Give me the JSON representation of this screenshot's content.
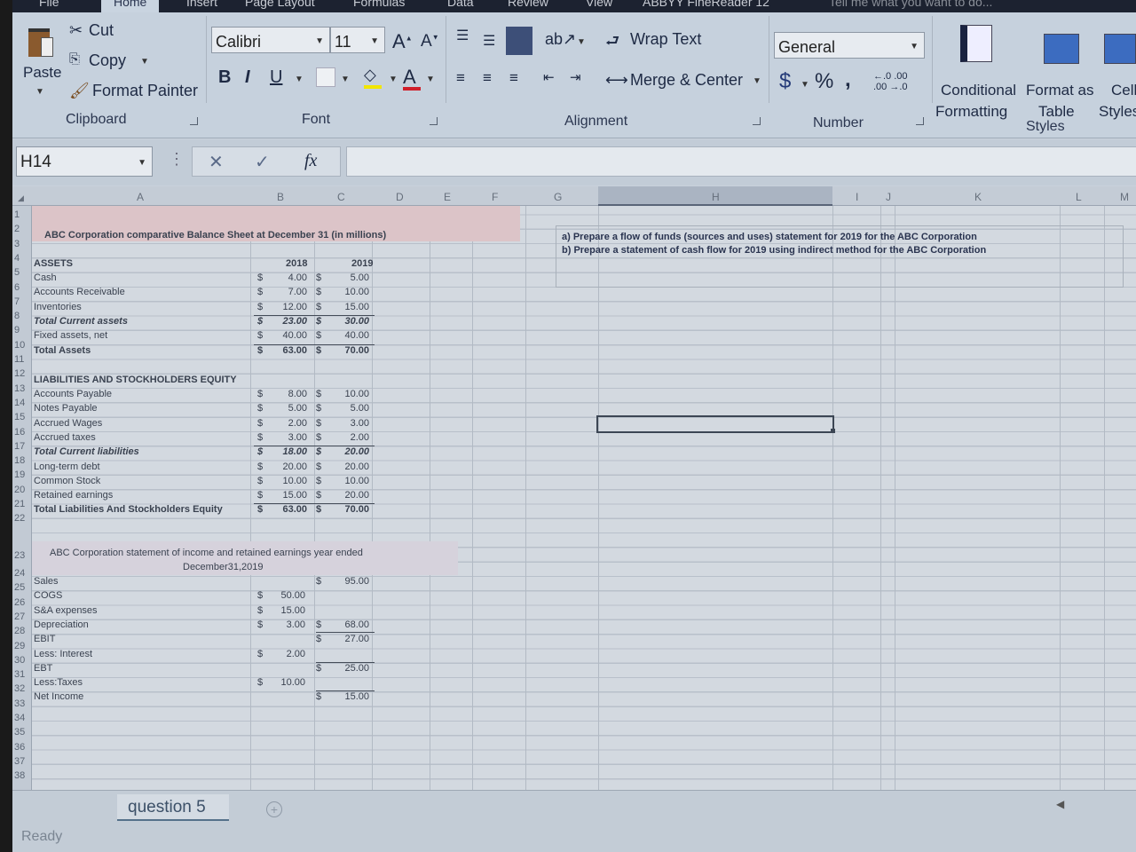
{
  "tabs": [
    "File",
    "Home",
    "Insert",
    "Page Layout",
    "Formulas",
    "Data",
    "Review",
    "View",
    "ABBYY FineReader 12"
  ],
  "tell_me": "Tell me what you want to do...",
  "ribbon": {
    "clipboard": {
      "paste": "Paste",
      "cut": "Cut",
      "copy": "Copy",
      "format_painter": "Format Painter",
      "label": "Clipboard"
    },
    "font": {
      "name": "Calibri",
      "size": "11",
      "bold": "B",
      "italic": "I",
      "underline": "U",
      "label": "Font",
      "fill_color": "#f2e600",
      "font_color": "#d01f2a"
    },
    "alignment": {
      "wrap_text": "Wrap Text",
      "merge_center": "Merge & Center",
      "label": "Alignment"
    },
    "number": {
      "format": "General",
      "currency": "$",
      "percent": "%",
      "comma": ",",
      "inc_decimal": "←.0 .00",
      "dec_decimal": ".00 →.0",
      "label": "Number"
    },
    "styles": {
      "conditional": "Conditional",
      "conditional2": "Formatting",
      "format_table": "Format as",
      "format_table2": "Table",
      "cell_styles": "Cell",
      "cell_styles2": "Styles",
      "label": "Styles"
    }
  },
  "formula_bar": {
    "name_box": "H14",
    "cancel": "✕",
    "enter": "✓",
    "fx": "fx",
    "content": ""
  },
  "columns": [
    "A",
    "B",
    "C",
    "D",
    "E",
    "F",
    "G",
    "H",
    "I",
    "J",
    "K",
    "L",
    "M"
  ],
  "rows": [
    "1",
    "2",
    "3",
    "4",
    "5",
    "6",
    "7",
    "8",
    "9",
    "10",
    "11",
    "12",
    "13",
    "14",
    "15",
    "16",
    "17",
    "18",
    "19",
    "20",
    "21",
    "22",
    "23",
    "24",
    "25",
    "26",
    "27",
    "28",
    "29",
    "30",
    "31",
    "32",
    "33",
    "34",
    "35",
    "36",
    "37",
    "38"
  ],
  "balance_sheet": {
    "title": "ABC Corporation comparative Balance Sheet at December 31   (in millions)",
    "assets_header": "ASSETS",
    "year1": "2018",
    "year2": "2019",
    "currency": "$",
    "asset_rows": [
      {
        "label": "Cash",
        "v2018": "4.00",
        "v2019": "5.00",
        "style": "normal"
      },
      {
        "label": "Accounts Receivable",
        "v2018": "7.00",
        "v2019": "10.00",
        "style": "normal"
      },
      {
        "label": "Inventories",
        "v2018": "12.00",
        "v2019": "15.00",
        "style": "normal"
      },
      {
        "label": "Total Current assets",
        "v2018": "23.00",
        "v2019": "30.00",
        "style": "bold-italic"
      },
      {
        "label": "Fixed assets, net",
        "v2018": "40.00",
        "v2019": "40.00",
        "style": "normal"
      },
      {
        "label": "Total Assets",
        "v2018": "63.00",
        "v2019": "70.00",
        "style": "bold"
      }
    ],
    "liab_header": "LIABILITIES AND STOCKHOLDERS EQUITY",
    "liab_rows": [
      {
        "label": "Accounts Payable",
        "v2018": "8.00",
        "v2019": "10.00",
        "style": "normal"
      },
      {
        "label": "Notes Payable",
        "v2018": "5.00",
        "v2019": "5.00",
        "style": "normal"
      },
      {
        "label": "Accrued Wages",
        "v2018": "2.00",
        "v2019": "3.00",
        "style": "normal"
      },
      {
        "label": "Accrued taxes",
        "v2018": "3.00",
        "v2019": "2.00",
        "style": "normal"
      },
      {
        "label": "Total Current liabilities",
        "v2018": "18.00",
        "v2019": "20.00",
        "style": "bold-italic"
      },
      {
        "label": "Long-term debt",
        "v2018": "20.00",
        "v2019": "20.00",
        "style": "normal"
      },
      {
        "label": "Common Stock",
        "v2018": "10.00",
        "v2019": "10.00",
        "style": "normal"
      },
      {
        "label": "Retained earnings",
        "v2018": "15.00",
        "v2019": "20.00",
        "style": "normal"
      },
      {
        "label": "Total Liabilities And Stockholders Equity",
        "v2018": "63.00",
        "v2019": "70.00",
        "style": "bold"
      }
    ]
  },
  "income_statement": {
    "title_line1": "ABC Corporation statement of income and retained earnings year ended",
    "title_line2": "December31,2019",
    "rows": [
      {
        "label": "Sales",
        "col_b": "",
        "col_c": "95.00"
      },
      {
        "label": "COGS",
        "col_b": "50.00",
        "col_c": ""
      },
      {
        "label": "S&A expenses",
        "col_b": "15.00",
        "col_c": ""
      },
      {
        "label": "Depreciation",
        "col_b": "3.00",
        "col_c": "68.00"
      },
      {
        "label": "EBIT",
        "col_b": "",
        "col_c": "27.00"
      },
      {
        "label": "Less: Interest",
        "col_b": "2.00",
        "col_c": ""
      },
      {
        "label": "EBT",
        "col_b": "",
        "col_c": "25.00"
      },
      {
        "label": "Less:Taxes",
        "col_b": "10.00",
        "col_c": ""
      },
      {
        "label": "Net Income",
        "col_b": "",
        "col_c": "15.00"
      }
    ]
  },
  "tasks": [
    "a) Prepare a flow of funds (sources and uses) statement for 2019 for the ABC Corporation",
    "b) Prepare a statement of cash flow for 2019 using indirect method for the ABC Corporation"
  ],
  "sheet_tabs": [
    "question 5"
  ],
  "add_sheet": "+",
  "status": "Ready"
}
